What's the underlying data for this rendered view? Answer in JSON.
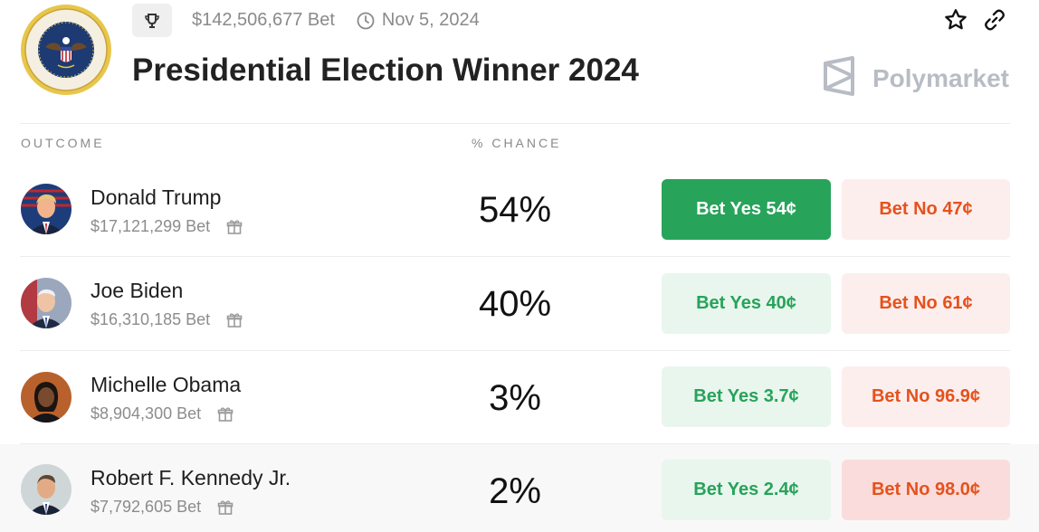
{
  "header": {
    "volume": "$142,506,677 Bet",
    "end_date": "Nov 5, 2024",
    "title": "Presidential Election Winner 2024",
    "brand": "Polymarket"
  },
  "columns": {
    "outcome": "OUTCOME",
    "chance": "% CHANCE"
  },
  "outcomes": [
    {
      "name": "Donald Trump",
      "volume": "$17,121,299 Bet",
      "chance": "54%",
      "yes_label": "Bet Yes 54¢",
      "no_label": "Bet No 47¢"
    },
    {
      "name": "Joe Biden",
      "volume": "$16,310,185 Bet",
      "chance": "40%",
      "yes_label": "Bet Yes 40¢",
      "no_label": "Bet No 61¢"
    },
    {
      "name": "Michelle Obama",
      "volume": "$8,904,300 Bet",
      "chance": "3%",
      "yes_label": "Bet Yes 3.7¢",
      "no_label": "Bet No 96.9¢"
    },
    {
      "name": "Robert F. Kennedy Jr.",
      "volume": "$7,792,605 Bet",
      "chance": "2%",
      "yes_label": "Bet Yes 2.4¢",
      "no_label": "Bet No 98.0¢"
    }
  ],
  "seal": {
    "text": "SEAL OF THE PRESIDENT OF THE UNITED STATES"
  },
  "icons": {
    "meta": "trophy-icon",
    "date": "clock-icon",
    "favorite": "star-icon",
    "share": "link-icon",
    "brand": "polymarket-logo-icon",
    "rewards": "gift-icon"
  },
  "colors": {
    "yes_active_bg": "#27a35a",
    "yes_bg": "#e9f6ee",
    "yes_text": "#27a35a",
    "no_bg": "#fdeeee",
    "no_text": "#e5521c"
  }
}
